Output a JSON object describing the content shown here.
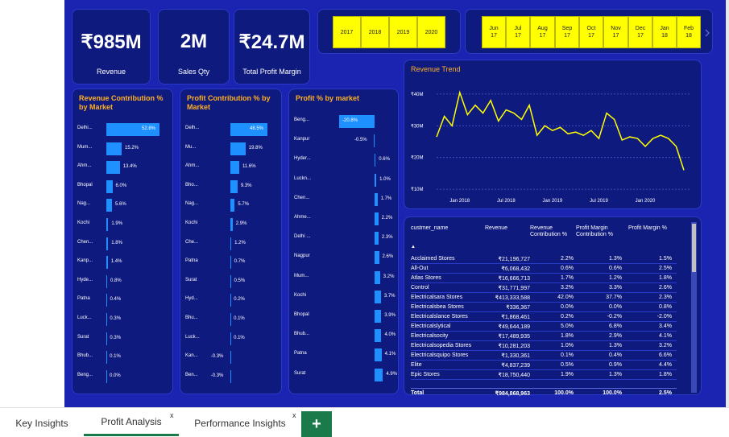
{
  "kpis": [
    {
      "value": "₹985M",
      "label": "Revenue"
    },
    {
      "value": "2M",
      "label": "Sales Qty"
    },
    {
      "value": "₹24.7M",
      "label": "Total Profit Margin"
    }
  ],
  "year_slicer": [
    "2017",
    "2018",
    "2019",
    "2020"
  ],
  "month_slicer": [
    {
      "m": "Jun",
      "y": "17"
    },
    {
      "m": "Jul",
      "y": "17"
    },
    {
      "m": "Aug",
      "y": "17"
    },
    {
      "m": "Sep",
      "y": "17"
    },
    {
      "m": "Oct",
      "y": "17"
    },
    {
      "m": "Nov",
      "y": "17"
    },
    {
      "m": "Dec",
      "y": "17"
    },
    {
      "m": "Jan",
      "y": "18"
    },
    {
      "m": "Feb",
      "y": "18"
    }
  ],
  "revenue_contribution": {
    "title": "Revenue Contribution % by Market",
    "rows": [
      {
        "label": "Delhi...",
        "value": 52.8,
        "text": "52.8%"
      },
      {
        "label": "Mum...",
        "value": 15.2,
        "text": "15.2%"
      },
      {
        "label": "Ahm...",
        "value": 13.4,
        "text": "13.4%"
      },
      {
        "label": "Bhopal",
        "value": 6.0,
        "text": "6.0%"
      },
      {
        "label": "Nag...",
        "value": 5.6,
        "text": "5.6%"
      },
      {
        "label": "Kochi",
        "value": 1.9,
        "text": "1.9%"
      },
      {
        "label": "Chen...",
        "value": 1.8,
        "text": "1.8%"
      },
      {
        "label": "Kanp...",
        "value": 1.4,
        "text": "1.4%"
      },
      {
        "label": "Hyde...",
        "value": 0.8,
        "text": "0.8%"
      },
      {
        "label": "Patna",
        "value": 0.4,
        "text": "0.4%"
      },
      {
        "label": "Luck...",
        "value": 0.3,
        "text": "0.3%"
      },
      {
        "label": "Surat",
        "value": 0.3,
        "text": "0.3%"
      },
      {
        "label": "Bhub...",
        "value": 0.1,
        "text": "0.1%"
      },
      {
        "label": "Beng...",
        "value": 0.0,
        "text": "0.0%"
      }
    ]
  },
  "profit_contribution": {
    "title": "Profit Contribution % by Market",
    "rows": [
      {
        "label": "Delh...",
        "value": 48.5,
        "text": "48.5%"
      },
      {
        "label": "Mu...",
        "value": 19.8,
        "text": "19.8%"
      },
      {
        "label": "Ahm...",
        "value": 11.6,
        "text": "11.6%"
      },
      {
        "label": "Bho...",
        "value": 9.3,
        "text": "9.3%"
      },
      {
        "label": "Nag...",
        "value": 5.7,
        "text": "5.7%"
      },
      {
        "label": "Kochi",
        "value": 2.9,
        "text": "2.9%"
      },
      {
        "label": "Che...",
        "value": 1.2,
        "text": "1.2%"
      },
      {
        "label": "Patna",
        "value": 0.7,
        "text": "0.7%"
      },
      {
        "label": "Surat",
        "value": 0.5,
        "text": "0.5%"
      },
      {
        "label": "Hyd...",
        "value": 0.2,
        "text": "0.2%"
      },
      {
        "label": "Bhu...",
        "value": 0.1,
        "text": "0.1%"
      },
      {
        "label": "Luck...",
        "value": 0.1,
        "text": "0.1%"
      },
      {
        "label": "Kan...",
        "value": -0.3,
        "text": "-0.3%"
      },
      {
        "label": "Ben...",
        "value": -0.3,
        "text": "-0.3%"
      }
    ]
  },
  "profit_pct": {
    "title": "Profit % by market",
    "rows": [
      {
        "label": "Beng...",
        "value": -20.8,
        "text": "-20.8%"
      },
      {
        "label": "Kanpur",
        "value": -0.5,
        "text": "-0.5%"
      },
      {
        "label": "Hyder...",
        "value": 0.6,
        "text": "0.6%"
      },
      {
        "label": "Luckn...",
        "value": 1.0,
        "text": "1.0%"
      },
      {
        "label": "Chen...",
        "value": 1.7,
        "text": "1.7%"
      },
      {
        "label": "Ahme...",
        "value": 2.2,
        "text": "2.2%"
      },
      {
        "label": "Delhi ...",
        "value": 2.3,
        "text": "2.3%"
      },
      {
        "label": "Nagpur",
        "value": 2.6,
        "text": "2.6%"
      },
      {
        "label": "Mum...",
        "value": 3.2,
        "text": "3.2%"
      },
      {
        "label": "Kochi",
        "value": 3.7,
        "text": "3.7%"
      },
      {
        "label": "Bhopal",
        "value": 3.9,
        "text": "3.9%"
      },
      {
        "label": "Bhub...",
        "value": 4.0,
        "text": "4.0%"
      },
      {
        "label": "Patna",
        "value": 4.1,
        "text": "4.1%"
      },
      {
        "label": "Surat",
        "value": 4.9,
        "text": "4.9%"
      }
    ]
  },
  "chart_data": {
    "type": "line",
    "title": "Revenue Trend",
    "xlabel": "",
    "ylabel": "",
    "y_ticks": [
      "₹10M",
      "₹20M",
      "₹30M",
      "₹40M"
    ],
    "x_ticks": [
      "Jan 2018",
      "Jul 2018",
      "Jan 2019",
      "Jul 2019",
      "Jan 2020"
    ],
    "ylim": [
      8,
      42
    ],
    "grid": true,
    "x": [
      "Oct 2017",
      "Nov 2017",
      "Dec 2017",
      "Jan 2018",
      "Feb 2018",
      "Mar 2018",
      "Apr 2018",
      "May 2018",
      "Jun 2018",
      "Jul 2018",
      "Aug 2018",
      "Sep 2018",
      "Oct 2018",
      "Nov 2018",
      "Dec 2018",
      "Jan 2019",
      "Feb 2019",
      "Mar 2019",
      "Apr 2019",
      "May 2019",
      "Jun 2019",
      "Jul 2019",
      "Aug 2019",
      "Sep 2019",
      "Oct 2019",
      "Nov 2019",
      "Dec 2019",
      "Jan 2020",
      "Feb 2020",
      "Mar 2020",
      "Apr 2020",
      "May 2020",
      "Jun 2020"
    ],
    "series": [
      {
        "values": [
          26.5,
          33,
          30,
          40.5,
          33.5,
          36.5,
          34,
          38,
          31.5,
          35,
          34,
          32,
          36.5,
          27,
          30,
          28.5,
          29.5,
          27.5,
          28,
          27,
          28.5,
          26,
          34,
          32,
          25.5,
          26.5,
          26,
          23.5,
          26,
          27,
          26,
          23.5,
          16
        ]
      }
    ]
  },
  "table": {
    "headers": [
      "custmer_name",
      "Revenue",
      "Revenue Contribution %",
      "Profit Margin Contribution %",
      "Profit Margin %"
    ],
    "rows": [
      [
        "Acclaimed Stores",
        "₹21,196,727",
        "2.2%",
        "1.3%",
        "1.5%"
      ],
      [
        "All-Out",
        "₹6,068,432",
        "0.6%",
        "0.6%",
        "2.5%"
      ],
      [
        "Atlas Stores",
        "₹16,666,713",
        "1.7%",
        "1.2%",
        "1.8%"
      ],
      [
        "Control",
        "₹31,771,997",
        "3.2%",
        "3.3%",
        "2.6%"
      ],
      [
        "Electricalsara Stores",
        "₹413,333,588",
        "42.0%",
        "37.7%",
        "2.3%"
      ],
      [
        "Electricalsbea Stores",
        "₹336,367",
        "0.0%",
        "0.0%",
        "0.8%"
      ],
      [
        "Electricalslance Stores",
        "₹1,868,461",
        "0.2%",
        "-0.2%",
        "-2.0%"
      ],
      [
        "Electricalslytical",
        "₹49,644,189",
        "5.0%",
        "6.8%",
        "3.4%"
      ],
      [
        "Electricalsocity",
        "₹17,489,935",
        "1.8%",
        "2.9%",
        "4.1%"
      ],
      [
        "Electricalsopedia Stores",
        "₹10,281,203",
        "1.0%",
        "1.3%",
        "3.2%"
      ],
      [
        "Electricalsquipo Stores",
        "₹1,330,361",
        "0.1%",
        "0.4%",
        "6.6%"
      ],
      [
        "Elite",
        "₹4,837,239",
        "0.5%",
        "0.9%",
        "4.4%"
      ],
      [
        "Epic Stores",
        "₹18,750,440",
        "1.9%",
        "1.3%",
        "1.8%"
      ]
    ],
    "total": [
      "Total",
      "₹984,868,963",
      "100.0%",
      "100.0%",
      "2.5%"
    ]
  },
  "tabs": [
    {
      "label": "Key Insights"
    },
    {
      "label": "Profit Analysis"
    },
    {
      "label": "Performance Insights"
    }
  ],
  "tab_close": "x",
  "add_tab": "+",
  "sort_arrow": "▲",
  "colors": {
    "canvas": "#1a24b0",
    "card": "#0f1a7e",
    "bar": "#1e90ff",
    "line": "#ffff00",
    "title": "#ffb020",
    "slicer": "#ffff00",
    "add": "#1a7a4a"
  }
}
